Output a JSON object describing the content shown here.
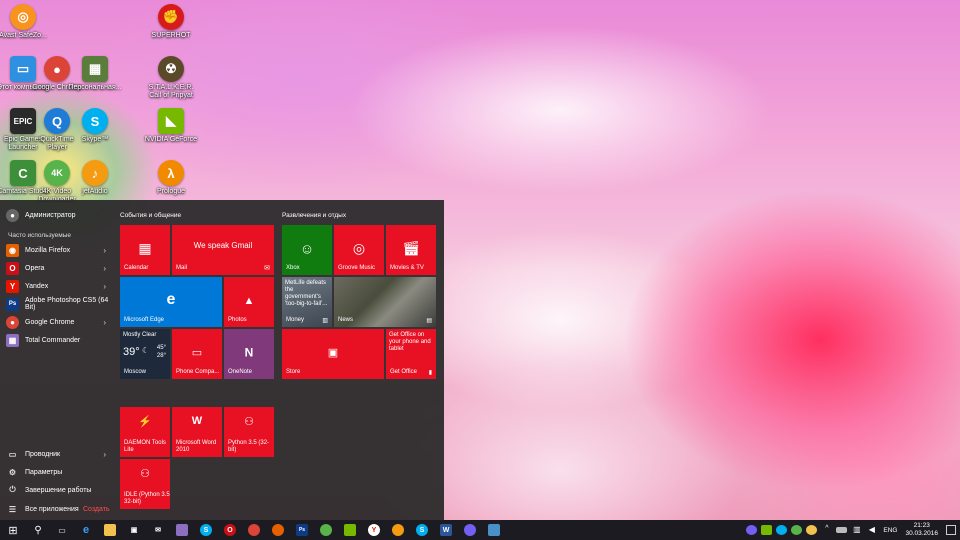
{
  "desktop": {
    "icons": [
      {
        "label": "Avast SafeZo...",
        "glyph": "◎",
        "color": "#f7931e"
      },
      {
        "label": "Этот компьютер",
        "glyph": "▭",
        "color": "#2f8fe0"
      },
      {
        "label": "Epic Games Launcher",
        "glyph": "EPIC",
        "color": "#2a2a2a"
      },
      {
        "label": "Camtasia Studio",
        "glyph": "C",
        "color": "#3d8f3a"
      },
      {
        "label": "Google Chrome",
        "glyph": "●",
        "color": "#db4437"
      },
      {
        "label": "QuickTime Player",
        "glyph": "Q",
        "color": "#1e7bd6"
      },
      {
        "label": "4K Video Downloader",
        "glyph": "4K",
        "color": "#58b44a"
      },
      {
        "label": "Персональная...",
        "glyph": "▦",
        "color": "#5a7d3c"
      },
      {
        "label": "Skype™",
        "glyph": "S",
        "color": "#00aff0"
      },
      {
        "label": "jetAudio",
        "glyph": "♪",
        "color": "#f59b12"
      },
      {
        "label": "SUPERHOT",
        "glyph": "✊",
        "color": "#d81a1a"
      },
      {
        "label": "S.T.A.L.K.E.R. Call of Pripyat",
        "glyph": "☢",
        "color": "#5a4a2a"
      },
      {
        "label": "NVIDIA GeForce",
        "glyph": "◣",
        "color": "#76b900"
      },
      {
        "label": "Prologue",
        "glyph": "λ",
        "color": "#f28a00"
      }
    ]
  },
  "start_menu": {
    "user": "Администратор",
    "frequent_header": "Часто используемые",
    "apps": [
      {
        "label": "Mozilla Firefox",
        "color": "#e66000",
        "glyph": "◉"
      },
      {
        "label": "Opera",
        "color": "#cc0f16",
        "glyph": "O"
      },
      {
        "label": "Yandex",
        "color": "#e61400",
        "glyph": "Y"
      },
      {
        "label": "Adobe Photoshop CS5 (64 Bit)",
        "color": "#0d3b86",
        "glyph": "Ps"
      },
      {
        "label": "Google Chrome",
        "color": "#db4437",
        "glyph": "●"
      },
      {
        "label": "Total Commander",
        "color": "#8d6fc2",
        "glyph": "▦"
      }
    ],
    "bottom": {
      "explorer": "Проводник",
      "settings": "Параметры",
      "power": "Завершение работы",
      "all_apps": "Все приложения",
      "create": "Создать"
    },
    "group1_title": "События и общение",
    "group2_title": "Развлечения и отдых",
    "tiles": {
      "calendar": "Calendar",
      "mail": "Mail",
      "mail_headline": "We speak Gmail",
      "edge": "Microsoft Edge",
      "photos": "Photos",
      "weather_cond": "Mostly Clear",
      "weather_temp": "39°",
      "weather_hi": "45°",
      "weather_lo": "28°",
      "weather_city": "Moscow",
      "phone": "Phone Compa...",
      "onenote": "OneNote",
      "xbox": "Xbox",
      "groove": "Groove Music",
      "movies": "Movies & TV",
      "money_headline": "MetLife defeats the government's 'too-big-to-fail'...",
      "money": "Money",
      "news": "News",
      "store": "Store",
      "office_text": "Get Office on your phone and tablet",
      "office": "Get Office",
      "daemon": "DAEMON Tools Lite",
      "word": "Microsoft Word 2010",
      "python": "Python 3.5 (32-bit)",
      "idle": "IDLE (Python 3.5 32-bit)"
    }
  },
  "taskbar": {
    "lang": "ENG",
    "time": "21:23",
    "date": "30.03.2016"
  }
}
